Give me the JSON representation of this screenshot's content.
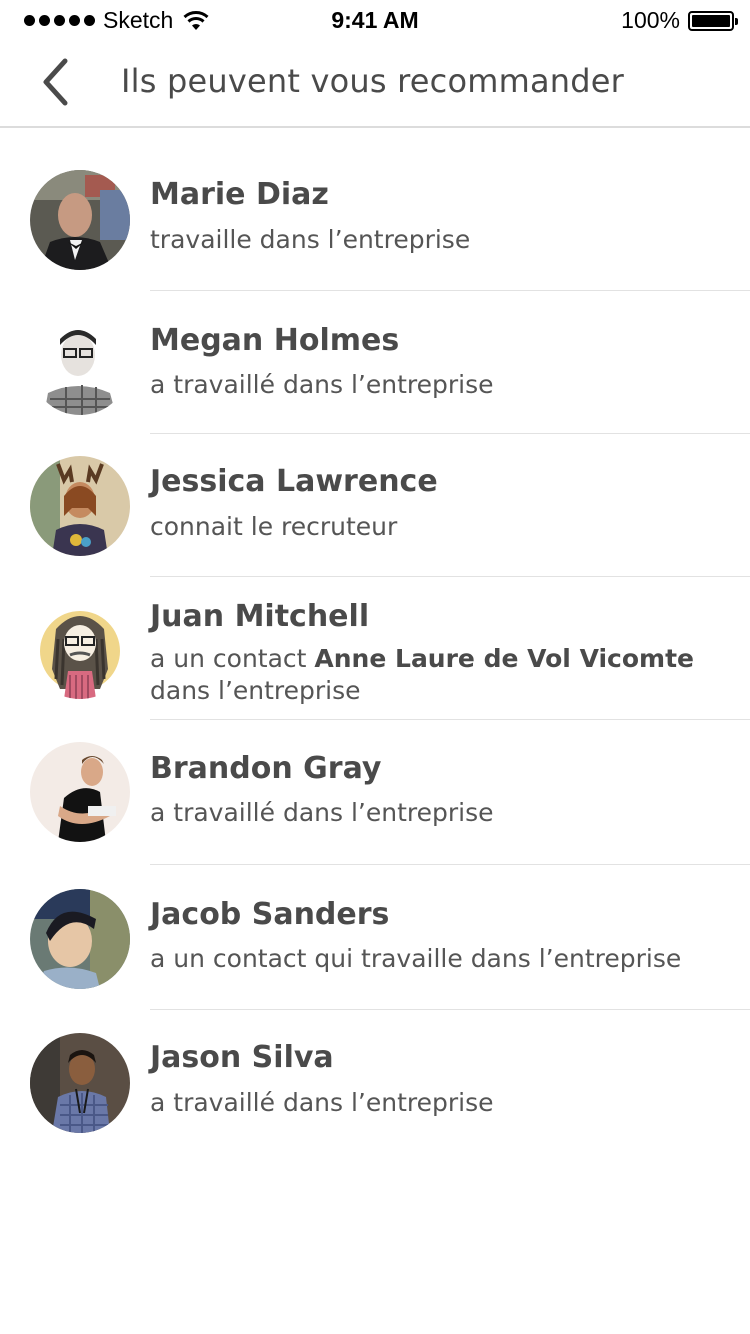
{
  "status_bar": {
    "carrier": "Sketch",
    "time": "9:41 AM",
    "battery": "100%"
  },
  "nav": {
    "title": "Ils peuvent vous recommander",
    "back_icon": "chevron-left-icon"
  },
  "people": [
    {
      "name": "Marie Diaz",
      "desc": "travaille dans l’entreprise"
    },
    {
      "name": "Megan Holmes",
      "desc": "a travaillé dans l’entreprise"
    },
    {
      "name": "Jessica Lawrence",
      "desc": "connait le recruteur"
    },
    {
      "name": "Juan Mitchell",
      "desc_prefix": "a un contact ",
      "desc_contact": "Anne Laure de Vol Vicomte",
      "desc_suffix": "dans l’entreprise"
    },
    {
      "name": "Brandon Gray",
      "desc": "a travaillé dans l’entreprise"
    },
    {
      "name": "Jacob Sanders",
      "desc": "a un contact qui travaille dans l’entreprise"
    },
    {
      "name": "Jason Silva",
      "desc": "a travaillé dans l’entreprise"
    }
  ],
  "colors": {
    "text": "#4a4a4a",
    "divider": "#e2e2e2"
  }
}
